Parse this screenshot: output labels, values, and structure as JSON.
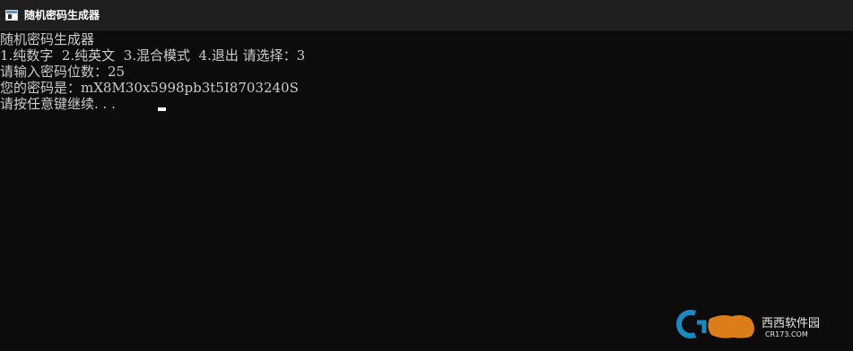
{
  "window": {
    "title": "随机密码生成器"
  },
  "console": {
    "lines": [
      "随机密码生成器",
      "1.纯数字  2.纯英文  3.混合模式  4.退出 请选择：3",
      "请输入密码位数：25",
      "您的密码是：mX8M30x5998pb3t5I8703240S",
      "请按任意键继续. . ."
    ]
  },
  "watermark": {
    "brand": "西西软件园",
    "url": "CR173.COM"
  }
}
